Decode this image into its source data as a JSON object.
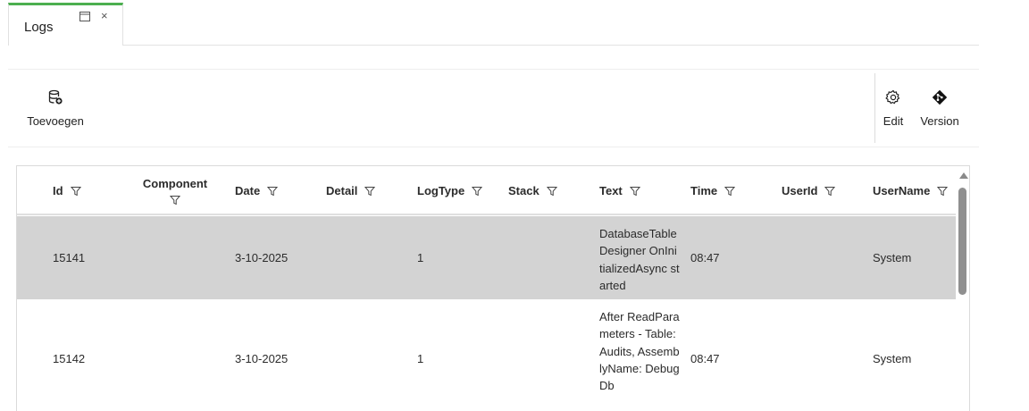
{
  "tab": {
    "title": "Logs",
    "popout_icon": "window-popout-icon",
    "close_glyph": "×"
  },
  "toolbar": {
    "add_label": "Toevoegen",
    "add_icon": "database-add-icon",
    "edit_label": "Edit",
    "edit_icon": "gear-icon",
    "version_label": "Version",
    "version_icon": "git-commit-icon"
  },
  "grid": {
    "columns": [
      "Id",
      "Component",
      "Date",
      "Detail",
      "LogType",
      "Stack",
      "Text",
      "Time",
      "UserId",
      "UserName"
    ],
    "rows": [
      {
        "Id": "15141",
        "Component": "",
        "Date": "3-10-2025",
        "Detail": "",
        "LogType": "1",
        "Stack": "",
        "Text": "DatabaseTable Designer OnInitializedAsync started",
        "Time": "08:47",
        "UserId": "",
        "UserName": "System"
      },
      {
        "Id": "15142",
        "Component": "",
        "Date": "3-10-2025",
        "Detail": "",
        "LogType": "1",
        "Stack": "",
        "Text": "After ReadParameters - Table: Audits, AssemblyName: DebugDb",
        "Time": "08:47",
        "UserId": "",
        "UserName": "System"
      }
    ]
  },
  "colors": {
    "tab_accent": "#4caf50",
    "selected_row": "#d3d3d3",
    "scroll_thumb": "#8f8f8f"
  }
}
